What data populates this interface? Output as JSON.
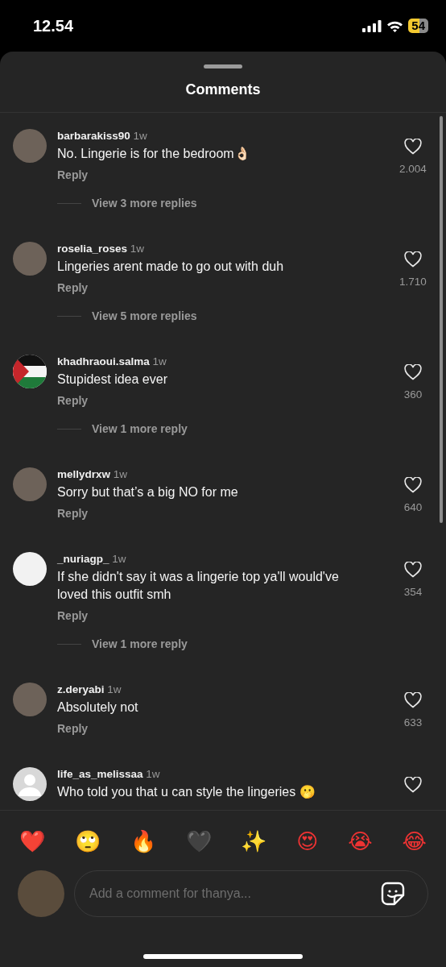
{
  "status_bar": {
    "time": "12.54",
    "battery": "54"
  },
  "sheet": {
    "title": "Comments"
  },
  "comments": [
    {
      "user": "barbarakiss90",
      "time": "1w",
      "text": "No. Lingerie is for the bedroom👌🏻",
      "reply": "Reply",
      "likes": "2.004",
      "more_replies": "View 3 more replies",
      "kind": "photo"
    },
    {
      "user": "roselia_roses",
      "time": "1w",
      "text": "Lingeries arent made to go out with duh",
      "reply": "Reply",
      "likes": "1.710",
      "more_replies": "View 5 more replies",
      "kind": "photo"
    },
    {
      "user": "khadhraoui.salma",
      "time": "1w",
      "text": "Stupidest idea ever",
      "reply": "Reply",
      "likes": "360",
      "more_replies": "View 1 more reply",
      "kind": "flag"
    },
    {
      "user": "mellydrxw",
      "time": "1w",
      "text": "Sorry but that’s a big NO for me",
      "reply": "Reply",
      "likes": "640",
      "kind": "photo"
    },
    {
      "user": "_nuriagp_",
      "time": "1w",
      "text": "If she didn't say it was a lingerie top ya'll would've loved this outfit smh",
      "reply": "Reply",
      "likes": "354",
      "more_replies": "View 1 more reply",
      "kind": "drawing"
    },
    {
      "user": "z.deryabi",
      "time": "1w",
      "text": "Absolutely not",
      "reply": "Reply",
      "likes": "633",
      "kind": "photo"
    },
    {
      "user": "life_as_melissaa",
      "time": "1w",
      "text": "Who told you that u can style  the lingeries 🫢",
      "kind": "default"
    }
  ],
  "reactions": [
    "❤️",
    "🙄",
    "🔥",
    "🖤",
    "✨",
    "😍",
    "😭",
    "😂"
  ],
  "composer": {
    "placeholder": "Add a comment for thanya..."
  }
}
